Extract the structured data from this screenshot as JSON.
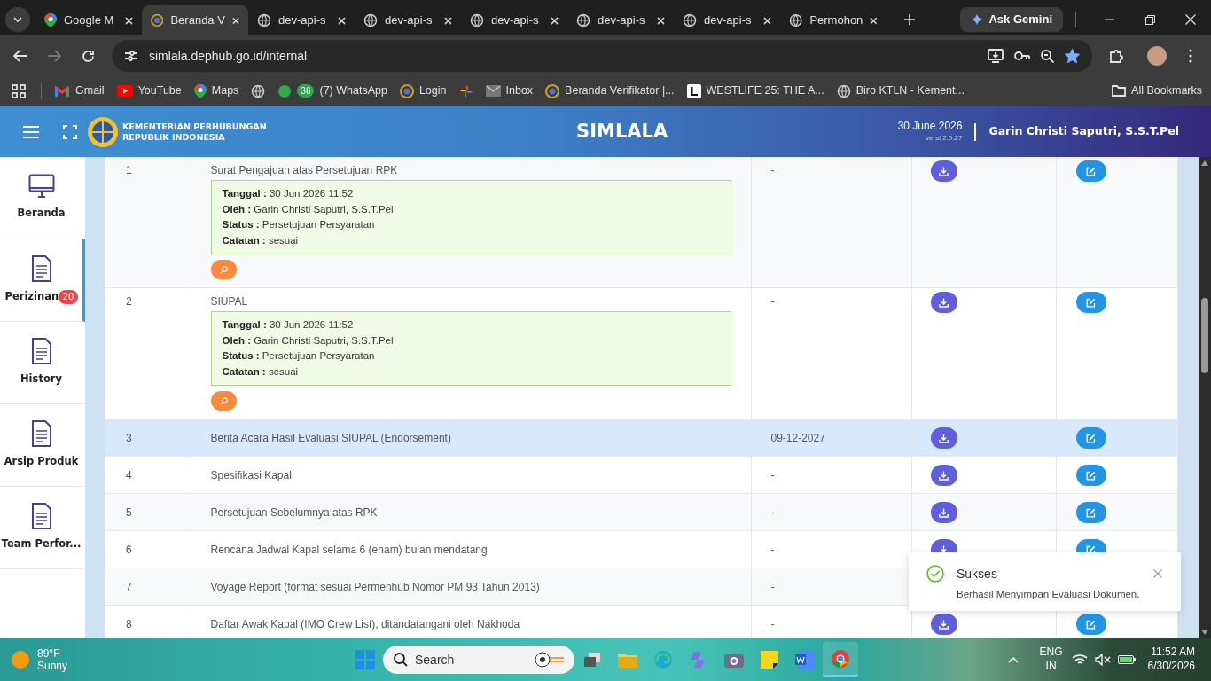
{
  "browser": {
    "tabs": [
      {
        "title": "Google M",
        "kind": "maps",
        "selected": false
      },
      {
        "title": "Beranda V",
        "kind": "site",
        "selected": true
      },
      {
        "title": "dev-api-s",
        "kind": "globe",
        "selected": false
      },
      {
        "title": "dev-api-s",
        "kind": "globe",
        "selected": false
      },
      {
        "title": "dev-api-s",
        "kind": "globe",
        "selected": false
      },
      {
        "title": "dev-api-s",
        "kind": "globe",
        "selected": false
      },
      {
        "title": "dev-api-s",
        "kind": "globe",
        "selected": false
      },
      {
        "title": "Permohon",
        "kind": "globe",
        "selected": false
      }
    ],
    "ask_button": "Ask Gemini",
    "address": "simlala.dephub.go.id/internal",
    "bookmarked": true,
    "bookmarks": [
      {
        "label": "Gmail",
        "kind": "gmail"
      },
      {
        "label": "YouTube",
        "kind": "youtube"
      },
      {
        "label": "Maps",
        "kind": "maps"
      },
      {
        "kind": "globe"
      },
      {
        "label": "(7) WhatsApp",
        "kind": "whatsapp",
        "badge": "36"
      },
      {
        "label": "Login",
        "kind": "site"
      },
      {
        "kind": "pinwheel"
      },
      {
        "label": "Inbox",
        "kind": "mail"
      },
      {
        "label": "Beranda Verifikator |...",
        "kind": "site"
      },
      {
        "label": "WESTLIFE 25: THE A...",
        "kind": "letter"
      },
      {
        "label": "Biro KTLN - Kement...",
        "kind": "globe"
      }
    ],
    "all_bookmarks": "All Bookmarks"
  },
  "header": {
    "org": [
      "KEMENTERIAN PERHUBUNGAN",
      "REPUBLIK INDONESIA"
    ],
    "title": "SIMLALA",
    "date": "30 June 2026",
    "version": "versi 2.0.27",
    "user": "Garin Christi Saputri, S.S.T.Pel"
  },
  "sidebar": {
    "items": [
      {
        "label": "Beranda",
        "kind": "monitor",
        "selected": false
      },
      {
        "label": "Perizinan",
        "kind": "document",
        "selected": true,
        "badge": "20"
      },
      {
        "label": "History",
        "kind": "document",
        "selected": false
      },
      {
        "label": "Arsip Produk",
        "kind": "document",
        "selected": false
      },
      {
        "label": "Team Perfor...",
        "kind": "document",
        "selected": false
      }
    ]
  },
  "table": {
    "rows": [
      {
        "no": "1",
        "name": "Surat Pengajuan atas Persetujuan RPK",
        "evaluation": [
          "**Tanggal :** 30 Jun 2026 11:52",
          "**Oleh :** Garin Christi Saputri, S.S.T.Pel",
          "**Status :** Persetujuan Persyaratan",
          "**Catatan :** sesuai"
        ],
        "date": "-",
        "hovered": false
      },
      {
        "no": "2",
        "name": "SIUPAL",
        "evaluation": [
          "**Tanggal :** 30 Jun 2026 11:52",
          "**Oleh :** Garin Christi Saputri, S.S.T.Pel",
          "**Status :** Persetujuan Persyaratan",
          "**Catatan :** sesuai"
        ],
        "date": "-",
        "hovered": false
      },
      {
        "no": "3",
        "name": "Berita Acara Hasil Evaluasi SIUPAL (Endorsement)",
        "date": "09-12-2027",
        "hovered": true
      },
      {
        "no": "4",
        "name": "Spesifikasi Kapal",
        "date": "-",
        "hovered": false
      },
      {
        "no": "5",
        "name": "Persetujuan Sebelumnya atas RPK",
        "date": "-",
        "hovered": false
      },
      {
        "no": "6",
        "name": "Rencana Jadwal Kapal selama 6 (enam) bulan mendatang",
        "date": "-",
        "hovered": false
      },
      {
        "no": "7",
        "name": "Voyage Report (format sesuai Permenhub Nomor PM 93 Tahun 2013)",
        "date": "-",
        "hovered": false
      },
      {
        "no": "8",
        "name": "Daftar Awak Kapal (IMO Crew List), ditandatangani oleh Nakhoda",
        "date": "-",
        "hovered": false
      }
    ]
  },
  "toast": {
    "title": "Sukses",
    "message": "Berhasil Menyimpan Evaluasi Dokumen."
  },
  "taskbar": {
    "temperature": "89°F",
    "weather": "Sunny",
    "search_placeholder": "Search",
    "language": "ENG",
    "region": "IN",
    "time": "11:52 AM",
    "date": "6/30/2026"
  }
}
